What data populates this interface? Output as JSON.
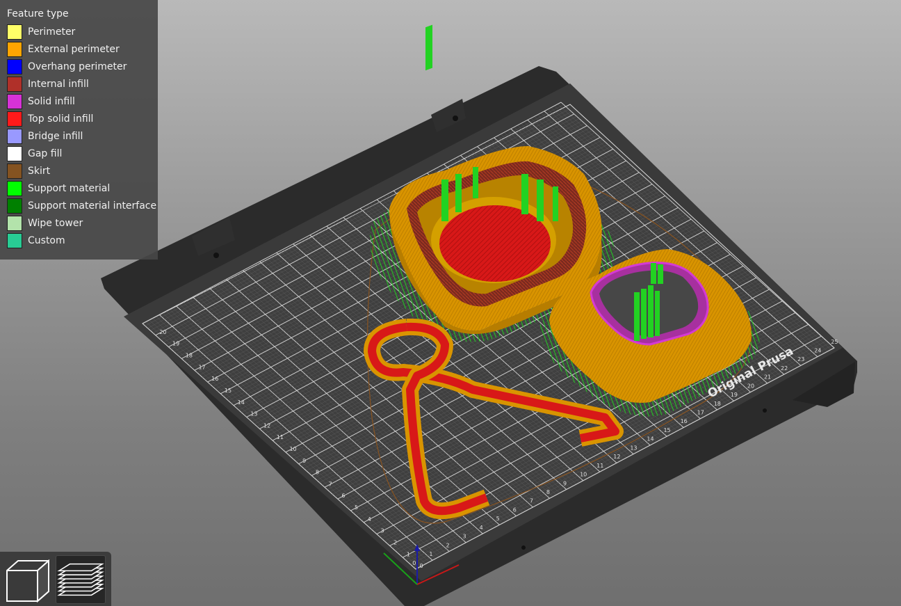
{
  "legend": {
    "title": "Feature type",
    "items": [
      {
        "label": "Perimeter",
        "color": "#FFFF68"
      },
      {
        "label": "External perimeter",
        "color": "#FFA500"
      },
      {
        "label": "Overhang perimeter",
        "color": "#0000FF"
      },
      {
        "label": "Internal infill",
        "color": "#B03029"
      },
      {
        "label": "Solid infill",
        "color": "#D732D7"
      },
      {
        "label": "Top solid infill",
        "color": "#FF1A1A"
      },
      {
        "label": "Bridge infill",
        "color": "#9999FF"
      },
      {
        "label": "Gap fill",
        "color": "#FFFFFF"
      },
      {
        "label": "Skirt",
        "color": "#845321"
      },
      {
        "label": "Support material",
        "color": "#00FF00"
      },
      {
        "label": "Support material interface",
        "color": "#008000"
      },
      {
        "label": "Wipe tower",
        "color": "#B3E3AB"
      },
      {
        "label": "Custom",
        "color": "#28CC94"
      }
    ]
  },
  "bed": {
    "branding": "Original Prusa",
    "x_ticks": [
      "0",
      "1",
      "2",
      "3",
      "4",
      "5",
      "6",
      "7",
      "8",
      "9",
      "10",
      "11",
      "12",
      "13",
      "14",
      "15",
      "16",
      "17",
      "18",
      "19",
      "20",
      "21",
      "22",
      "23",
      "24",
      "25"
    ],
    "y_ticks": [
      "0",
      "1",
      "2",
      "3",
      "4",
      "5",
      "6",
      "7",
      "8",
      "9",
      "10",
      "11",
      "12",
      "13",
      "14",
      "15",
      "16",
      "17",
      "18",
      "19",
      "20"
    ]
  },
  "toolbar": {
    "model_view_icon": "cube-icon",
    "preview_view_icon": "layers-icon"
  }
}
